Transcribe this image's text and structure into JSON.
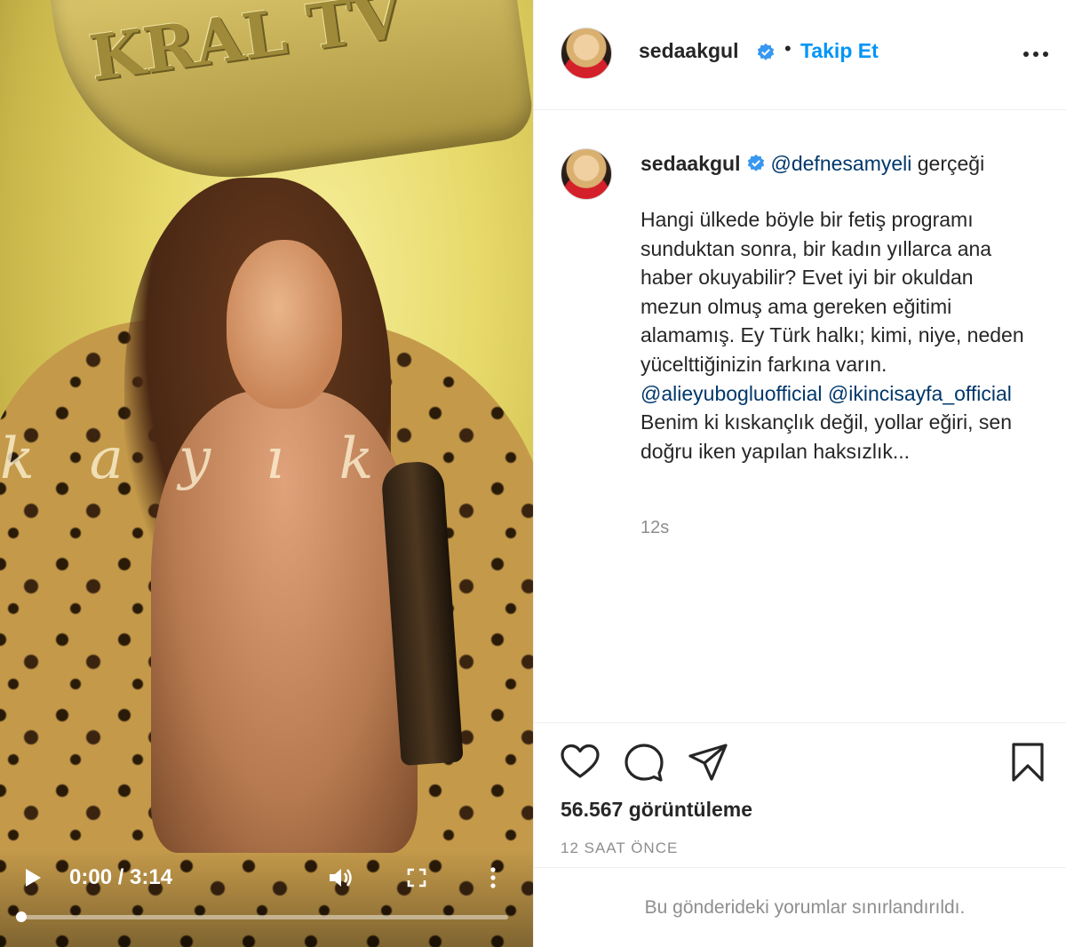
{
  "media": {
    "sign_text": "KRAL TV",
    "overlay_word": "kayık",
    "player": {
      "time_display": "0:00 / 3:14",
      "progress": 0
    }
  },
  "post": {
    "username": "sedaakgul",
    "verified": true,
    "separator": "•",
    "follow_label": "Takip Et",
    "caption": {
      "mention_1": "@defnesamyeli",
      "head_text": " gerçeği",
      "body_part1": "Hangi ülkede böyle bir fetiş programı sunduktan sonra, bir kadın yıllarca ana haber okuyabilir? Evet iyi bir okuldan mezun olmuş ama gereken eğitimi alamamış. Ey Türk halkı; kimi, niye, neden yücelttiğinizin farkına varın. ",
      "mention_2": "@alieyubogluofficial",
      "mention_3": "@ikincisayfa_official",
      "body_part2": " Benim ki kıskançlık değil, yollar eğiri, sen doğru iken yapılan haksızlık...",
      "time_ago": "12s"
    },
    "views": "56.567 görüntüleme",
    "posted": "12 SAAT ÖNCE",
    "comments_limited": "Bu gönderideki yorumlar sınırlandırıldı."
  },
  "colors": {
    "accent": "#0095f6",
    "mention": "#00376b",
    "muted": "#8e8e8e",
    "verified": "#3897f0"
  },
  "icons": [
    "play-icon",
    "volume-icon",
    "fullscreen-icon",
    "more-vertical-icon",
    "more-horizontal-icon",
    "verified-badge-icon",
    "heart-icon",
    "comment-icon",
    "share-icon",
    "bookmark-icon"
  ]
}
